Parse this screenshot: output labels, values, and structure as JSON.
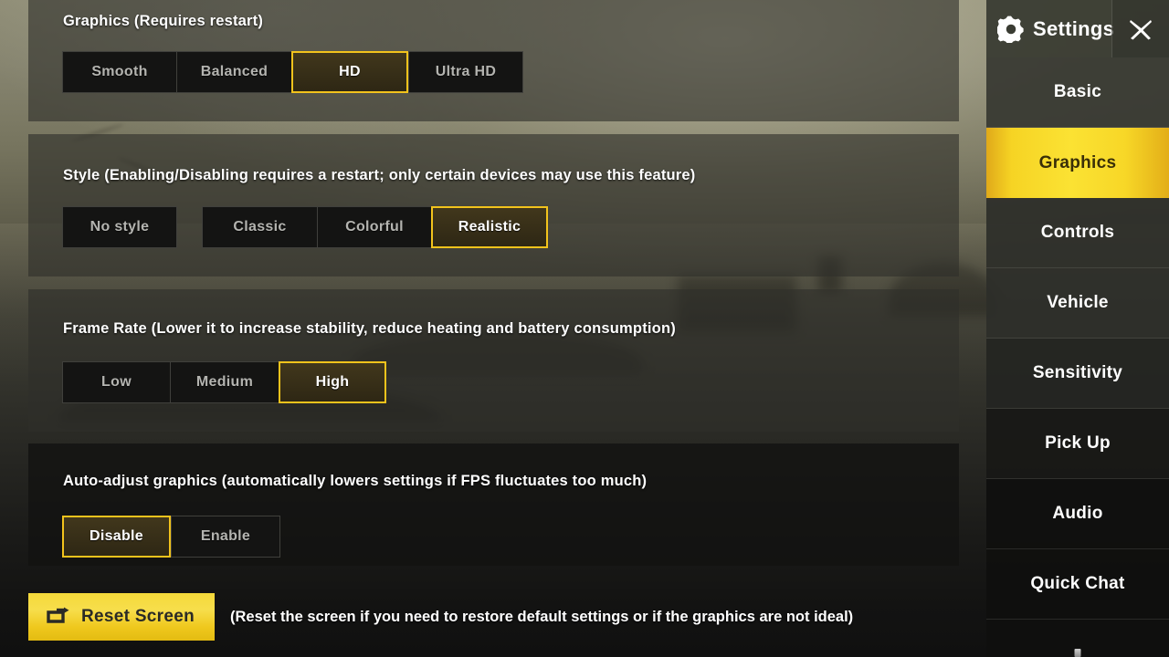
{
  "sidebar": {
    "title": "Settings",
    "gear_icon": "gear-icon",
    "close_icon": "close-x-icon",
    "items": [
      {
        "label": "Basic",
        "active": false
      },
      {
        "label": "Graphics",
        "active": true
      },
      {
        "label": "Controls",
        "active": false
      },
      {
        "label": "Vehicle",
        "active": false
      },
      {
        "label": "Sensitivity",
        "active": false
      },
      {
        "label": "Pick Up",
        "active": false
      },
      {
        "label": "Audio",
        "active": false
      },
      {
        "label": "Quick Chat",
        "active": false
      }
    ]
  },
  "sections": [
    {
      "title": "Graphics (Requires restart)",
      "options": [
        {
          "label": "Smooth",
          "selected": false
        },
        {
          "label": "Balanced",
          "selected": false
        },
        {
          "label": "HD",
          "selected": true
        },
        {
          "label": "Ultra HD",
          "selected": false
        }
      ]
    },
    {
      "title": "Style (Enabling/Disabling requires a restart; only certain devices may use this feature)",
      "options": [
        {
          "label": "No style",
          "selected": false
        },
        {
          "label": "Classic",
          "selected": false
        },
        {
          "label": "Colorful",
          "selected": false
        },
        {
          "label": "Realistic",
          "selected": true
        }
      ]
    },
    {
      "title": "Frame Rate (Lower it to increase stability, reduce heating and battery consumption)",
      "options": [
        {
          "label": "Low",
          "selected": false
        },
        {
          "label": "Medium",
          "selected": false
        },
        {
          "label": "High",
          "selected": true
        }
      ]
    },
    {
      "title": "Auto-adjust graphics (automatically lowers settings if FPS fluctuates too much)",
      "options": [
        {
          "label": "Disable",
          "selected": true
        },
        {
          "label": "Enable",
          "selected": false
        }
      ]
    }
  ],
  "reset": {
    "icon": "reset-arrow-icon",
    "label": "Reset Screen",
    "note": "(Reset the screen if you need to restore default settings or if the graphics are not ideal)"
  },
  "colors": {
    "accent_yellow": "#f2c31c",
    "selected_fill": "#3a3118",
    "panel": "#2e2f2a",
    "panel_dark": "#121211",
    "option_bg": "#141413",
    "option_text": "#b4b4b0",
    "text_white": "#ffffff"
  }
}
